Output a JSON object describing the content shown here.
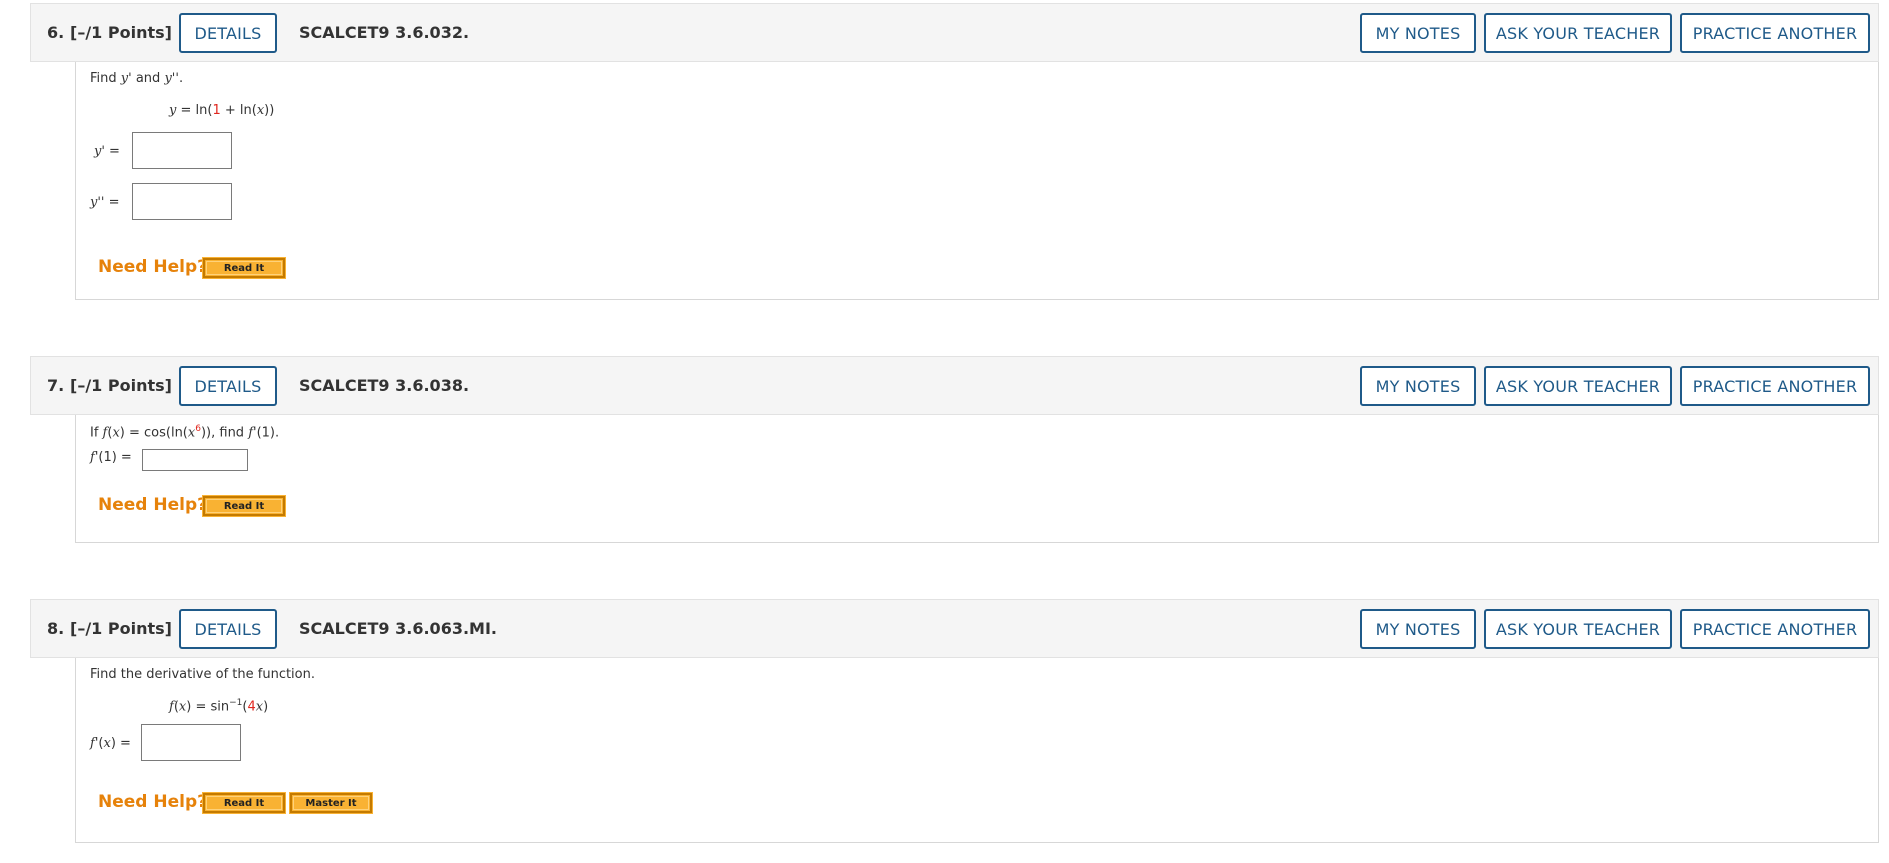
{
  "questions": [
    {
      "number": "6.",
      "points": "[–/1 Points]",
      "details_label": "DETAILS",
      "code": "SCALCET9 3.6.032.",
      "my_notes_label": "MY NOTES",
      "ask_teacher_label": "ASK YOUR TEACHER",
      "practice_label": "PRACTICE ANOTHER",
      "prompt_pre": "Find ",
      "prompt_y1": "y'",
      "prompt_and": " and ",
      "prompt_y2": "y''",
      "prompt_end": ".",
      "equation": {
        "lhs": "y",
        "mid": " = ln(",
        "red": "1",
        "rest": " + ln(",
        "var": "x",
        "tail": "))"
      },
      "answers": [
        {
          "label_var": "y'",
          "label_eq": " =",
          "value": ""
        },
        {
          "label_var": "y''",
          "label_eq": " =",
          "value": ""
        }
      ],
      "need_help": "Need Help?",
      "help_buttons": [
        "Read It"
      ]
    },
    {
      "number": "7.",
      "points": "[–/1 Points]",
      "details_label": "DETAILS",
      "code": "SCALCET9 3.6.038.",
      "my_notes_label": "MY NOTES",
      "ask_teacher_label": "ASK YOUR TEACHER",
      "practice_label": "PRACTICE ANOTHER",
      "prompt": {
        "a": "If ",
        "f": "f",
        "b": "(",
        "x": "x",
        "c": ") = cos(ln(",
        "x2": "x",
        "exp": "6",
        "d": ")), find ",
        "f2": "f",
        "e": "'(1)."
      },
      "answers": [
        {
          "label_var": "f",
          "label_eq": "'(1) =",
          "value": ""
        }
      ],
      "need_help": "Need Help?",
      "help_buttons": [
        "Read It"
      ]
    },
    {
      "number": "8.",
      "points": "[–/1 Points]",
      "details_label": "DETAILS",
      "code": "SCALCET9 3.6.063.MI.",
      "my_notes_label": "MY NOTES",
      "ask_teacher_label": "ASK YOUR TEACHER",
      "practice_label": "PRACTICE ANOTHER",
      "prompt_text": "Find the derivative of the function.",
      "equation": {
        "f": "f",
        "a": "(",
        "x": "x",
        "b": ") = sin",
        "sup": "−1",
        "c": "(",
        "red": "4",
        "x2": "x",
        "d": ")"
      },
      "answers": [
        {
          "label_var": "f",
          "label_mid": "'(",
          "label_x": "x",
          "label_eq": ") =",
          "value": ""
        }
      ],
      "need_help": "Need Help?",
      "help_buttons": [
        "Read It",
        "Master It"
      ]
    }
  ]
}
